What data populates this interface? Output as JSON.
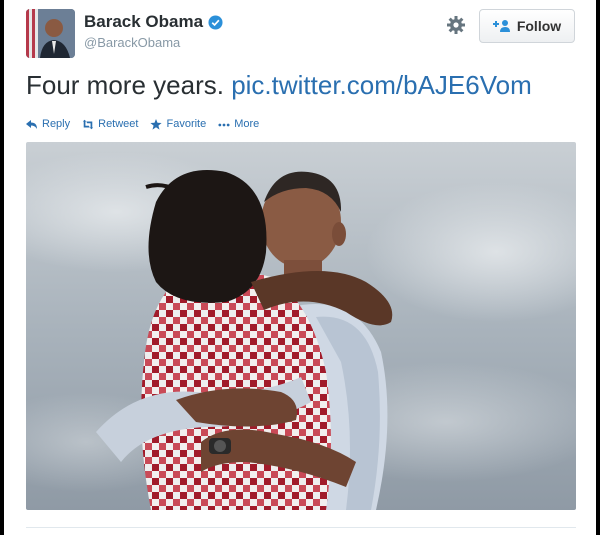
{
  "user": {
    "name": "Barack Obama",
    "handle": "@BarackObama"
  },
  "header": {
    "follow_label": "Follow"
  },
  "tweet": {
    "text": "Four more years.",
    "link": "pic.twitter.com/bAJE6Vom"
  },
  "actions": {
    "reply": "Reply",
    "retweet": "Retweet",
    "favorite": "Favorite",
    "more": "More"
  },
  "colors": {
    "link": "#2a6fb0",
    "verified": "#2b90d9"
  },
  "icons": [
    "verified-badge-icon",
    "gear-icon",
    "follow-user-icon",
    "reply-icon",
    "retweet-icon",
    "favorite-star-icon",
    "more-dots-icon"
  ]
}
